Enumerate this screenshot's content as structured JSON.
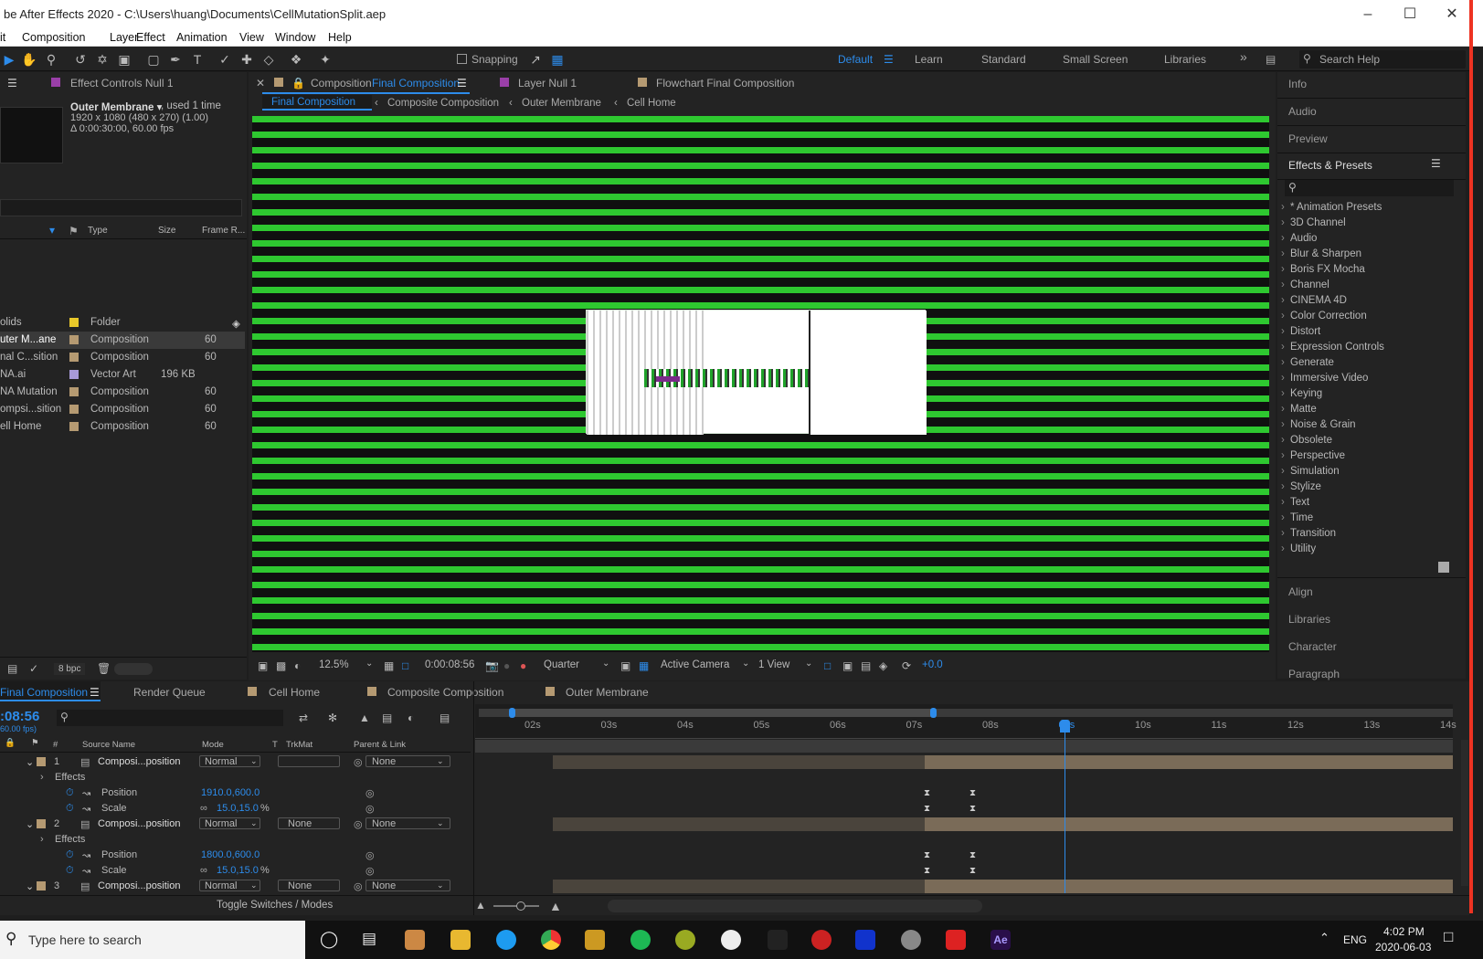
{
  "window": {
    "title": "be After Effects 2020 - C:\\Users\\huang\\Documents\\CellMutationSplit.aep"
  },
  "menu": [
    "it",
    "Composition",
    "Layer",
    "Effect",
    "Animation",
    "View",
    "Window",
    "Help"
  ],
  "toolbar": {
    "snapping": "Snapping",
    "workspaces": [
      "Default",
      "Learn",
      "Standard",
      "Small Screen",
      "Libraries"
    ],
    "search_placeholder": "Search Help"
  },
  "project": {
    "effect_controls_tab": "Effect Controls Null 1",
    "selected_name": "Outer Membrane ▾",
    "selected_used": ", used 1 time",
    "selected_dims": "1920 x 1080  (480 x 270) (1.00)",
    "selected_dur": "Δ 0:00:30:00, 60.00 fps",
    "col_type": "Type",
    "col_size": "Size",
    "col_frame": "Frame R...",
    "rows": [
      {
        "name": "olids",
        "type": "Folder",
        "size": "",
        "fr": "",
        "color": "#e8c82a"
      },
      {
        "name": "uter M...ane",
        "type": "Composition",
        "size": "",
        "fr": "60",
        "color": "#b59a72"
      },
      {
        "name": "nal C...sition",
        "type": "Composition",
        "size": "",
        "fr": "60",
        "color": "#b59a72"
      },
      {
        "name": "NA.ai",
        "type": "Vector Art",
        "size": "196 KB",
        "fr": "",
        "color": "#a89ad8"
      },
      {
        "name": "NA Mutation",
        "type": "Composition",
        "size": "",
        "fr": "60",
        "color": "#b59a72"
      },
      {
        "name": "ompsi...sition",
        "type": "Composition",
        "size": "",
        "fr": "60",
        "color": "#b59a72"
      },
      {
        "name": "ell Home",
        "type": "Composition",
        "size": "",
        "fr": "60",
        "color": "#b59a72"
      }
    ],
    "bpc": "8 bpc"
  },
  "comp": {
    "tab_prefix": "Composition",
    "tab_name": "Final Composition",
    "layer_tab": "Layer Null 1",
    "flow_tab": "Flowchart Final Composition",
    "breadcrumbs": [
      "Final Composition",
      "Composite Composition",
      "Outer Membrane",
      "Cell Home"
    ],
    "zoom": "12.5%",
    "timecode": "0:00:08:56",
    "resolution": "Quarter",
    "camera": "Active Camera",
    "views": "1 View",
    "exposure": "+0.0"
  },
  "right": {
    "panels_top": [
      "Info",
      "Audio",
      "Preview"
    ],
    "effects_title": "Effects & Presets",
    "effects": [
      "* Animation Presets",
      "3D Channel",
      "Audio",
      "Blur & Sharpen",
      "Boris FX Mocha",
      "Channel",
      "CINEMA 4D",
      "Color Correction",
      "Distort",
      "Expression Controls",
      "Generate",
      "Immersive Video",
      "Keying",
      "Matte",
      "Noise & Grain",
      "Obsolete",
      "Perspective",
      "Simulation",
      "Stylize",
      "Text",
      "Time",
      "Transition",
      "Utility"
    ],
    "panels_bottom": [
      "Align",
      "Libraries",
      "Character",
      "Paragraph"
    ]
  },
  "timeline": {
    "tabs": [
      "Final Composition",
      "Render Queue",
      "Cell Home",
      "Composite Composition",
      "Outer Membrane"
    ],
    "timecode": ":08:56",
    "fps": "60.00 fps)",
    "cols": {
      "num": "#",
      "source": "Source Name",
      "mode": "Mode",
      "t": "T",
      "trkmat": "TrkMat",
      "parent": "Parent & Link"
    },
    "ruler": [
      "02s",
      "03s",
      "04s",
      "05s",
      "06s",
      "07s",
      "08s",
      "09s",
      "10s",
      "11s",
      "12s",
      "13s",
      "14s"
    ],
    "rows": [
      {
        "kind": "layer",
        "num": "1",
        "name": "Composi...position",
        "mode": "Normal",
        "trk": "",
        "parent": "None"
      },
      {
        "kind": "group",
        "name": "Effects"
      },
      {
        "kind": "prop",
        "name": "Position",
        "value": "1910.0,600.0"
      },
      {
        "kind": "prop",
        "name": "Scale",
        "value": "15.0,15.0",
        "unit": "%"
      },
      {
        "kind": "layer",
        "num": "2",
        "name": "Composi...position",
        "mode": "Normal",
        "trk": "None",
        "parent": "None"
      },
      {
        "kind": "group",
        "name": "Effects"
      },
      {
        "kind": "prop",
        "name": "Position",
        "value": "1800.0,600.0"
      },
      {
        "kind": "prop",
        "name": "Scale",
        "value": "15.0,15.0",
        "unit": "%"
      },
      {
        "kind": "layer",
        "num": "3",
        "name": "Composi...position",
        "mode": "Normal",
        "trk": "None",
        "parent": "None"
      }
    ],
    "toggle": "Toggle Switches / Modes"
  },
  "taskbar": {
    "search": "Type here to search",
    "lang": "ENG",
    "time": "4:02 PM",
    "date": "2020-06-03"
  }
}
